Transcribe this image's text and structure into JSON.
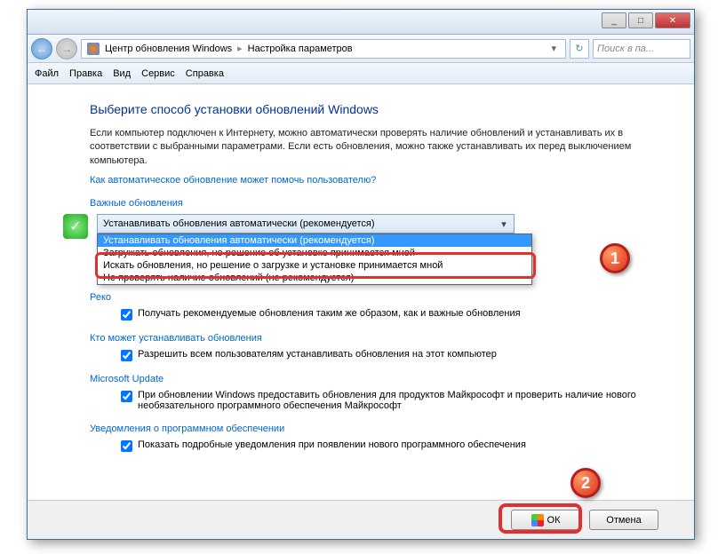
{
  "titlebar": {
    "min": "_",
    "max": "□",
    "close": "✕"
  },
  "nav": {
    "breadcrumb1": "Центр обновления Windows",
    "breadcrumb2": "Настройка параметров",
    "search_placeholder": "Поиск в па..."
  },
  "menu": {
    "file": "Файл",
    "edit": "Правка",
    "view": "Вид",
    "tools": "Сервис",
    "help": "Справка"
  },
  "heading": "Выберите способ установки обновлений Windows",
  "desc": "Если компьютер подключен к Интернету, можно автоматически проверять наличие обновлений и устанавливать их в соответствии с выбранными параметрами. Если есть обновления, можно также устанавливать их перед выключением компьютера.",
  "help_link": "Как автоматическое обновление может помочь пользователю?",
  "sections": {
    "important": "Важные обновления",
    "recommended_partial": "Реко",
    "who": "Кто может устанавливать обновления",
    "msupdate": "Microsoft Update",
    "notify": "Уведомления о программном обеспечении"
  },
  "combo": {
    "selected": "Устанавливать обновления автоматически (рекомендуется)",
    "options": [
      "Устанавливать обновления автоматически (рекомендуется)",
      "Загружать обновления, но решение об установке принимается мной",
      "Искать обновления, но решение о загрузке и установке принимается мной",
      "Не проверять наличие обновлений (не рекомендуется)"
    ]
  },
  "checks": {
    "recommended": "Получать рекомендуемые обновления таким же образом, как и важные обновления",
    "who": "Разрешить всем пользователям устанавливать обновления на этот компьютер",
    "msupdate": "При обновлении Windows предоставить обновления для продуктов Майкрософт и проверить наличие нового необязательного программного обеспечения Майкрософт",
    "notify": "Показать подробные уведомления при появлении нового программного обеспечения"
  },
  "buttons": {
    "ok": "ОК",
    "cancel": "Отмена"
  },
  "callouts": {
    "one": "1",
    "two": "2"
  }
}
